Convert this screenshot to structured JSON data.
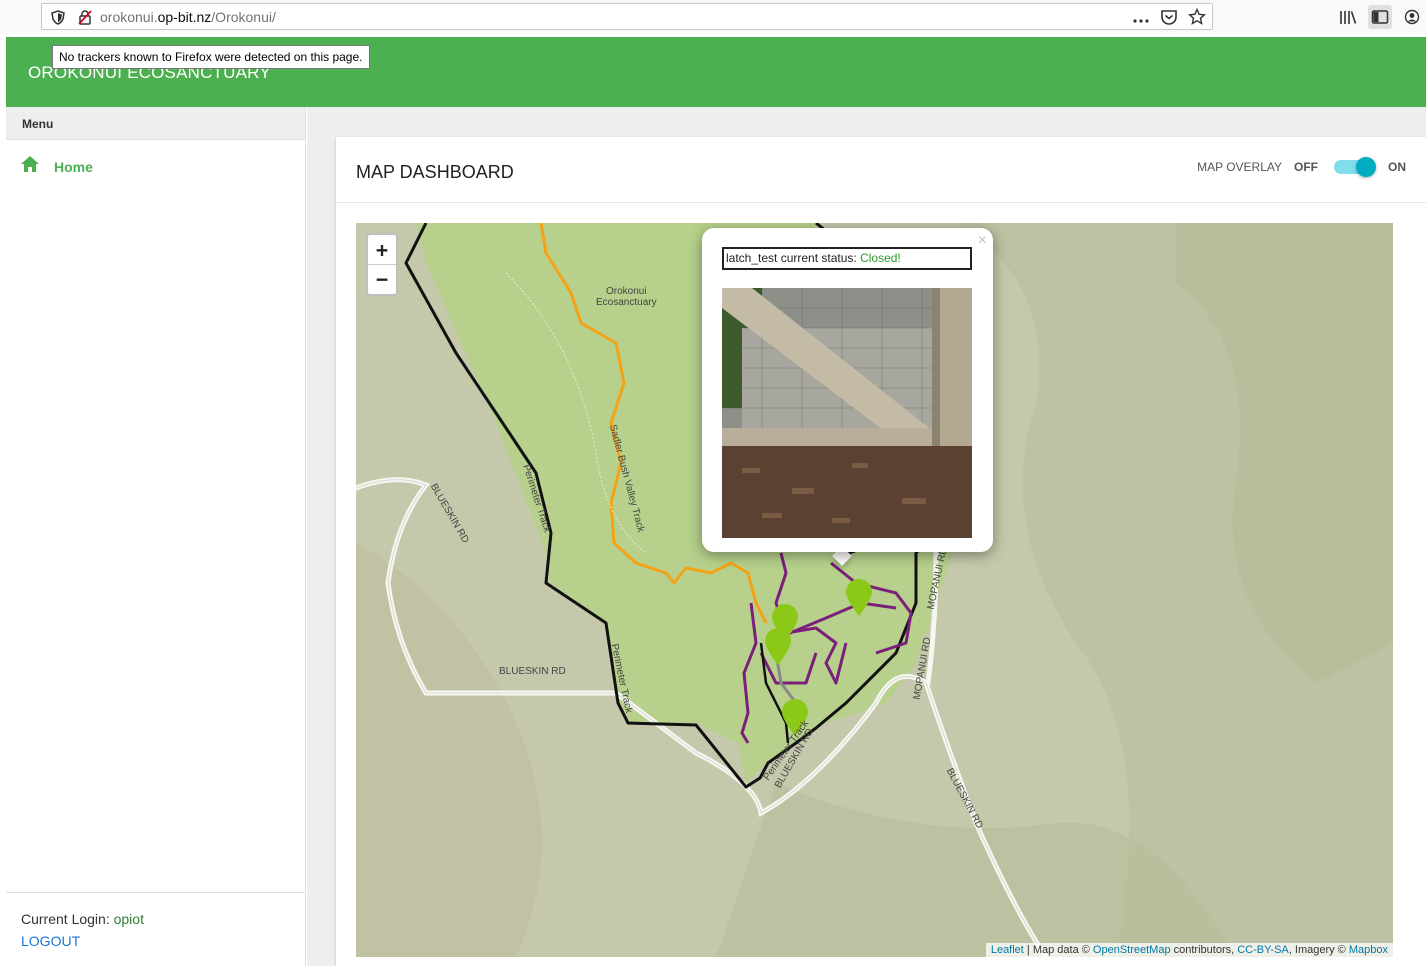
{
  "browser": {
    "url_prefix": "orokonui.",
    "url_domain": "op-bit.nz",
    "url_path": "/Orokonui/",
    "tracker_tooltip": "No trackers known to Firefox were detected on this page."
  },
  "app": {
    "title": "OROKONUI ECOSANCTUARY"
  },
  "sidebar": {
    "menu_label": "Menu",
    "items": [
      {
        "label": "Home",
        "icon": "home-icon",
        "active": true
      }
    ],
    "login_label": "Current Login:",
    "login_user": "opiot",
    "logout_label": "LOGOUT"
  },
  "dashboard": {
    "title": "MAP DASHBOARD",
    "overlay_label": "MAP OVERLAY",
    "overlay_off": "OFF",
    "overlay_on": "ON",
    "overlay_enabled": true
  },
  "map": {
    "zoom_in": "+",
    "zoom_out": "−",
    "labels": {
      "sanctuary_1": "Orokonui",
      "sanctuary_2": "Ecosanctuary",
      "blueskin_rd_1": "BLUESKIN RD",
      "blueskin_rd_2": "BLUESKIN RD",
      "blueskin_rd_3": "BLUESKIN RD",
      "blueskin_rd_4": "BLUESKIN RD",
      "mopanui_rd_1": "MOPANUI RD",
      "mopanui_rd_2": "MOPANUI RD",
      "perimeter_track_1": "Perimeter Track",
      "perimeter_track_2": "Perimeter Track",
      "perimeter_track_3": "Perimeter Track",
      "valley_track": "Sadler Bush Valley Track"
    },
    "popup": {
      "status_prefix": "latch_test current status: ",
      "status_value": "Closed!",
      "close": "×"
    },
    "attribution": {
      "leaflet": "Leaflet",
      "map_data": " | Map data © ",
      "osm": "OpenStreetMap",
      "contributors": " contributors, ",
      "license": "CC-BY-SA",
      "imagery": ", Imagery © ",
      "mapbox": "Mapbox"
    },
    "colors": {
      "sanctuary": "#b7d18c",
      "terrain": "#c6c8ac",
      "fence": "#111111",
      "track_orange": "#f5a316",
      "track_purple": "#7b1f7b",
      "marker": "#8bc818"
    }
  }
}
